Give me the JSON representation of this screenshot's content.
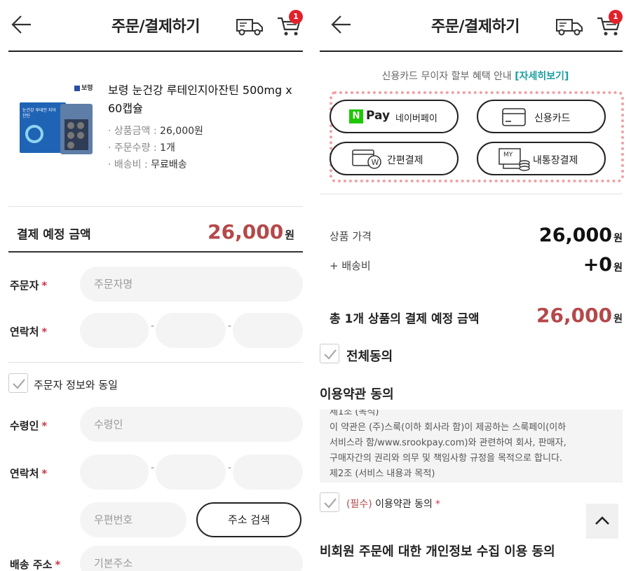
{
  "left": {
    "header": {
      "title": "주문/결제하기",
      "cart_badge": "1"
    },
    "product": {
      "brand": "보령",
      "name": "보령 눈건강 루테인지아잔틴 500mg x 60캡슐",
      "meta": [
        {
          "label": "· 상품금액 : ",
          "value": "26,000원"
        },
        {
          "label": "· 주문수량 : ",
          "value": "1개"
        },
        {
          "label": "· 배송비 : ",
          "value": "무료배송"
        }
      ],
      "box_text": "눈건강 루테인 지아잔틴"
    },
    "payment": {
      "label": "결제 예정 금액",
      "amount": "26,000",
      "unit": "원"
    },
    "orderer": {
      "label": "주문자",
      "placeholder": "주문자명"
    },
    "contact": {
      "label": "연락처"
    },
    "same_info": {
      "label": "주문자 정보와 동일"
    },
    "receiver": {
      "label": "수령인",
      "placeholder": "수령인"
    },
    "contact2": {
      "label": "연락처"
    },
    "postcode": {
      "placeholder": "우편번호",
      "button": "주소 검색"
    },
    "address": {
      "label": "배송 주소",
      "placeholder": "기본주소"
    },
    "required_mark": "*",
    "phone_dash": "-"
  },
  "right": {
    "header": {
      "title": "주문/결제하기",
      "cart_badge": "1"
    },
    "installment": {
      "text": "신용카드 무이자 할부 혜택 안내 ",
      "link": "[자세히보기]"
    },
    "methods": {
      "naver": {
        "n": "N",
        "pay": "Pay",
        "label": "네이버페이"
      },
      "card": {
        "label": "신용카드"
      },
      "simple": {
        "label": "간편결제"
      },
      "bank": {
        "label": "내통장결제",
        "my": "MY"
      }
    },
    "summary": {
      "price_label": "상품 가격",
      "price": "26,000",
      "unit": "원",
      "ship_label": "+ 배송비",
      "ship": "+0",
      "ship_unit": "원"
    },
    "total": {
      "label": "총 1개 상품의 결제 예정 금액",
      "amount": "26,000",
      "unit": "원"
    },
    "agree_all": "전체동의",
    "terms_title": "이용약관 동의",
    "terms_lines": [
      "제1조 (목적)",
      "이 약관은 (주)스룩(이하 회사라 함)이 제공하는 스룩페이(이하",
      "서비스라 함/www.srookpay.com)와 관련하여 회사, 판매자,",
      "구매자간의 권리와 의무 및 책임사항 규정을 목적으로 합니다.",
      "제2조 (서비스 내용과 목적)"
    ],
    "terms_required": {
      "tag": "(필수)",
      "label": " 이용약관 동의",
      "mark": "*"
    },
    "privacy_title": "비회원 주문에 대한 개인정보 수집 이용 동의"
  },
  "colors": {
    "accent_red": "#b5484a",
    "link_teal": "#1a9ea2",
    "badge_red": "#e0222b",
    "dotted_pink": "#f0a0a5"
  }
}
